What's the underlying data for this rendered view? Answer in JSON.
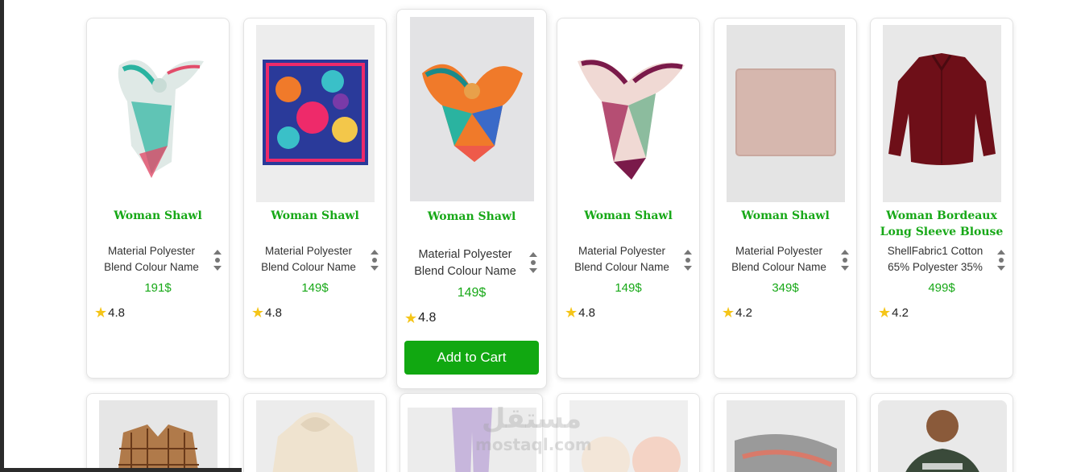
{
  "products": [
    {
      "title": "Woman Shawl",
      "desc": "Material Polyester Blend Colour Name",
      "price": "191$",
      "rating": "4.8",
      "image": "patterned-scarf-tied"
    },
    {
      "title": "Woman Shawl",
      "desc": "Material Polyester Blend Colour Name",
      "price": "149$",
      "rating": "4.8",
      "image": "patterned-scarf-square"
    },
    {
      "title": "Woman Shawl",
      "desc": "Material Polyester Blend Colour Name",
      "price": "149$",
      "rating": "4.8",
      "image": "patterned-scarf-tied"
    },
    {
      "title": "Woman Shawl",
      "desc": "Material Polyester Blend Colour Name",
      "price": "149$",
      "rating": "4.8",
      "image": "patterned-scarf-tied"
    },
    {
      "title": "Woman Shawl",
      "desc": "Material Polyester Blend Colour Name",
      "price": "349$",
      "rating": "4.2",
      "image": "plain-beige-shawl"
    },
    {
      "title": "Woman Bordeaux Long Sleeve Blouse",
      "desc": "ShellFabric1 Cotton 65% Polyester 35%",
      "price": "499$",
      "rating": "4.2",
      "image": "bordeaux-blouse"
    }
  ],
  "add_to_cart_label": "Add to Cart",
  "icons": {
    "rating": "star-icon",
    "scroll": "scroll-arrows-icon"
  },
  "colors": {
    "accent": "#17a817",
    "button": "#11a811",
    "star": "#f5c518"
  },
  "second_row_images": [
    "plaid-shirt",
    "cream-hoodie",
    "lavender-pants",
    "knit-accessories",
    "grey-knit-item",
    "man-in-tshirt"
  ],
  "watermark": {
    "arabic": "مستقل",
    "latin": "mostaql.com"
  }
}
